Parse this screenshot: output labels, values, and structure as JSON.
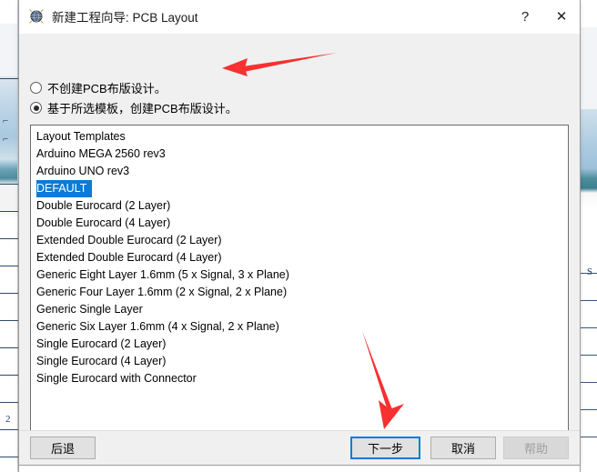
{
  "window": {
    "title_prefix": "新建工程向导",
    "title": "新建工程向导: PCB Layout",
    "icon": "globe-icon",
    "help_button": "?",
    "close_button": "✕"
  },
  "options": {
    "no_pcb": {
      "label": "不创建PCB布版设计。",
      "selected": false
    },
    "from_template": {
      "label": "基于所选模板，创建PCB布版设计。",
      "selected": true
    }
  },
  "template_list": {
    "header": "Layout Templates",
    "selected": "DEFAULT",
    "items": [
      "Layout Templates",
      "Arduino MEGA 2560 rev3",
      "Arduino UNO rev3",
      "DEFAULT",
      "Double Eurocard (2 Layer)",
      "Double Eurocard (4 Layer)",
      "Extended Double Eurocard (2 Layer)",
      "Extended Double Eurocard (4 Layer)",
      "Generic Eight Layer 1.6mm (5 x Signal, 3 x Plane)",
      "Generic Four Layer 1.6mm (2 x Signal, 2 x Plane)",
      "Generic Single Layer",
      "Generic Six Layer 1.6mm (4 x Signal, 2 x Plane)",
      "Single Eurocard (2 Layer)",
      "Single Eurocard (4 Layer)",
      "Single Eurocard with Connector"
    ]
  },
  "selected_path": "E:\\Proteus 8 Professional\\Templates\\DEFAULT.LTF",
  "footer": {
    "back": "后退",
    "next": "下一步",
    "cancel": "取消",
    "help": "帮助"
  },
  "annotations": {
    "arrow_to_radio": "red-arrow-left",
    "arrow_to_next": "red-arrow-down",
    "color": "#f73030"
  },
  "colors": {
    "selection_blue": "#0a7bd6",
    "dialog_bg": "#f0f0f0",
    "accent": "#0a7bd6"
  }
}
